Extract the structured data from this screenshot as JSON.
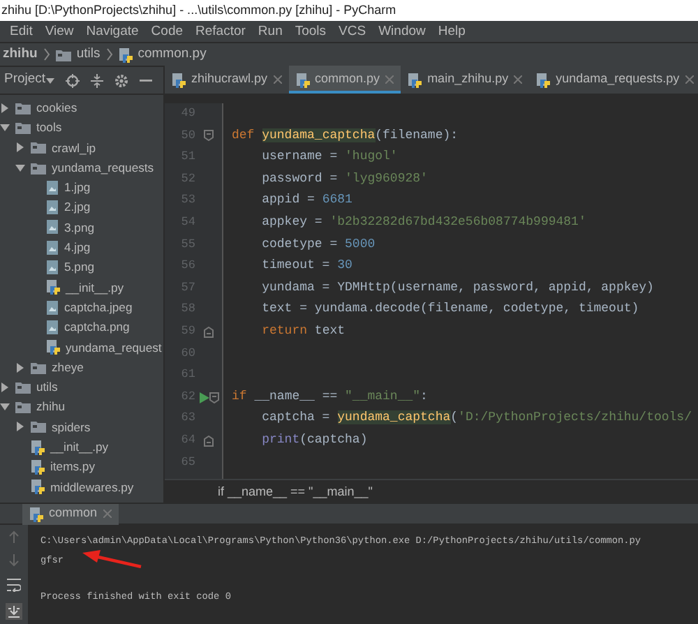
{
  "window": {
    "title": "zhihu [D:\\PythonProjects\\zhihu] - ...\\utils\\common.py [zhihu] - PyCharm"
  },
  "menu": [
    "Edit",
    "View",
    "Navigate",
    "Code",
    "Refactor",
    "Run",
    "Tools",
    "VCS",
    "Window",
    "Help"
  ],
  "navigation_bar": [
    {
      "label": "zhihu",
      "kind": "project"
    },
    {
      "label": "utils",
      "kind": "folder"
    },
    {
      "label": "common.py",
      "kind": "python"
    }
  ],
  "project_panel": {
    "title": "Project",
    "tree": [
      {
        "label": "cookies",
        "kind": "folder",
        "expanded": false
      },
      {
        "label": "tools",
        "kind": "folder",
        "expanded": true,
        "children": [
          {
            "label": "crawl_ip",
            "kind": "folder",
            "expanded": false
          },
          {
            "label": "yundama_requests",
            "kind": "folder",
            "expanded": true,
            "children": [
              {
                "label": "1.jpg",
                "kind": "image"
              },
              {
                "label": "2.jpg",
                "kind": "image"
              },
              {
                "label": "3.png",
                "kind": "image"
              },
              {
                "label": "4.jpg",
                "kind": "image"
              },
              {
                "label": "5.png",
                "kind": "image"
              },
              {
                "label": "__init__.py",
                "kind": "python"
              },
              {
                "label": "captcha.jpeg",
                "kind": "image"
              },
              {
                "label": "captcha.png",
                "kind": "image"
              },
              {
                "label": "yundama_request",
                "kind": "python"
              }
            ]
          },
          {
            "label": "zheye",
            "kind": "folder",
            "expanded": false
          }
        ]
      },
      {
        "label": "utils",
        "kind": "folder",
        "expanded": false
      },
      {
        "label": "zhihu",
        "kind": "folder",
        "expanded": true,
        "children": [
          {
            "label": "spiders",
            "kind": "folder",
            "expanded": false
          },
          {
            "label": "__init__.py",
            "kind": "python"
          },
          {
            "label": "items.py",
            "kind": "python"
          },
          {
            "label": "middlewares.py",
            "kind": "python"
          }
        ]
      }
    ]
  },
  "editor_tabs": [
    {
      "label": "zhihucrawl.py",
      "selected": false
    },
    {
      "label": "common.py",
      "selected": true
    },
    {
      "label": "main_zhihu.py",
      "selected": false
    },
    {
      "label": "yundama_requests.py",
      "selected": false
    }
  ],
  "editor": {
    "lines": [
      {
        "number": "49"
      },
      {
        "number": "50",
        "gutter_icons": [
          {
            "kind": "fold_start"
          }
        ],
        "tokens": [
          {
            "kind": "keyword",
            "text": "def "
          },
          {
            "kind": "usage",
            "text": "yundama_captcha"
          },
          {
            "kind": "plain",
            "text": "(filename):"
          }
        ]
      },
      {
        "number": "51",
        "tokens": [
          {
            "kind": "plain",
            "text": "    username = "
          },
          {
            "kind": "string",
            "text": "'hugol'"
          }
        ]
      },
      {
        "number": "52",
        "tokens": [
          {
            "kind": "plain",
            "text": "    password = "
          },
          {
            "kind": "string",
            "text": "'lyg960928'"
          }
        ]
      },
      {
        "number": "53",
        "tokens": [
          {
            "kind": "plain",
            "text": "    appid = "
          },
          {
            "kind": "number",
            "text": "6681"
          }
        ]
      },
      {
        "number": "54",
        "tokens": [
          {
            "kind": "plain",
            "text": "    appkey = "
          },
          {
            "kind": "string",
            "text": "'b2b32282d67bd432e56b08774b999481'"
          }
        ]
      },
      {
        "number": "55",
        "tokens": [
          {
            "kind": "plain",
            "text": "    codetype = "
          },
          {
            "kind": "number",
            "text": "5000"
          }
        ]
      },
      {
        "number": "56",
        "tokens": [
          {
            "kind": "plain",
            "text": "    timeout = "
          },
          {
            "kind": "number",
            "text": "30"
          }
        ]
      },
      {
        "number": "57",
        "tokens": [
          {
            "kind": "plain",
            "text": "    yundama = YDMHttp(username, password, appid, appkey)"
          }
        ]
      },
      {
        "number": "58",
        "tokens": [
          {
            "kind": "plain",
            "text": "    text = yundama.decode(filename, codetype, timeout)"
          }
        ]
      },
      {
        "number": "59",
        "gutter_icons": [
          {
            "kind": "fold_end"
          }
        ],
        "tokens": [
          {
            "kind": "keyword",
            "text": "    return"
          },
          {
            "kind": "plain",
            "text": " text"
          }
        ]
      },
      {
        "number": "60"
      },
      {
        "number": "61"
      },
      {
        "number": "62",
        "gutter_icons": [
          {
            "kind": "run"
          },
          {
            "kind": "fold_start"
          }
        ],
        "tokens": [
          {
            "kind": "keyword",
            "text": "if"
          },
          {
            "kind": "plain",
            "text": " __name__ == "
          },
          {
            "kind": "string",
            "text": "\"__main__\""
          },
          {
            "kind": "plain",
            "text": ":"
          }
        ]
      },
      {
        "number": "63",
        "tokens": [
          {
            "kind": "plain",
            "text": "    captcha = "
          },
          {
            "kind": "usage",
            "text": "yundama_captcha"
          },
          {
            "kind": "plain",
            "text": "("
          },
          {
            "kind": "string",
            "text": "'D:/PythonProjects/zhihu/tools/"
          }
        ]
      },
      {
        "number": "64",
        "gutter_icons": [
          {
            "kind": "fold_end"
          }
        ],
        "tokens": [
          {
            "kind": "builtin",
            "text": "    print"
          },
          {
            "kind": "plain",
            "text": "(captcha)"
          }
        ]
      },
      {
        "number": "65"
      }
    ],
    "breadcrumb": "if __name__ == \"__main__\""
  },
  "run_panel": {
    "tab": "common",
    "command": "C:\\Users\\admin\\AppData\\Local\\Programs\\Python\\Python36\\python.exe D:/PythonProjects/zhihu/utils/common.py",
    "lines": [
      "gfsr"
    ],
    "exit_message": "Process finished with exit code 0"
  }
}
